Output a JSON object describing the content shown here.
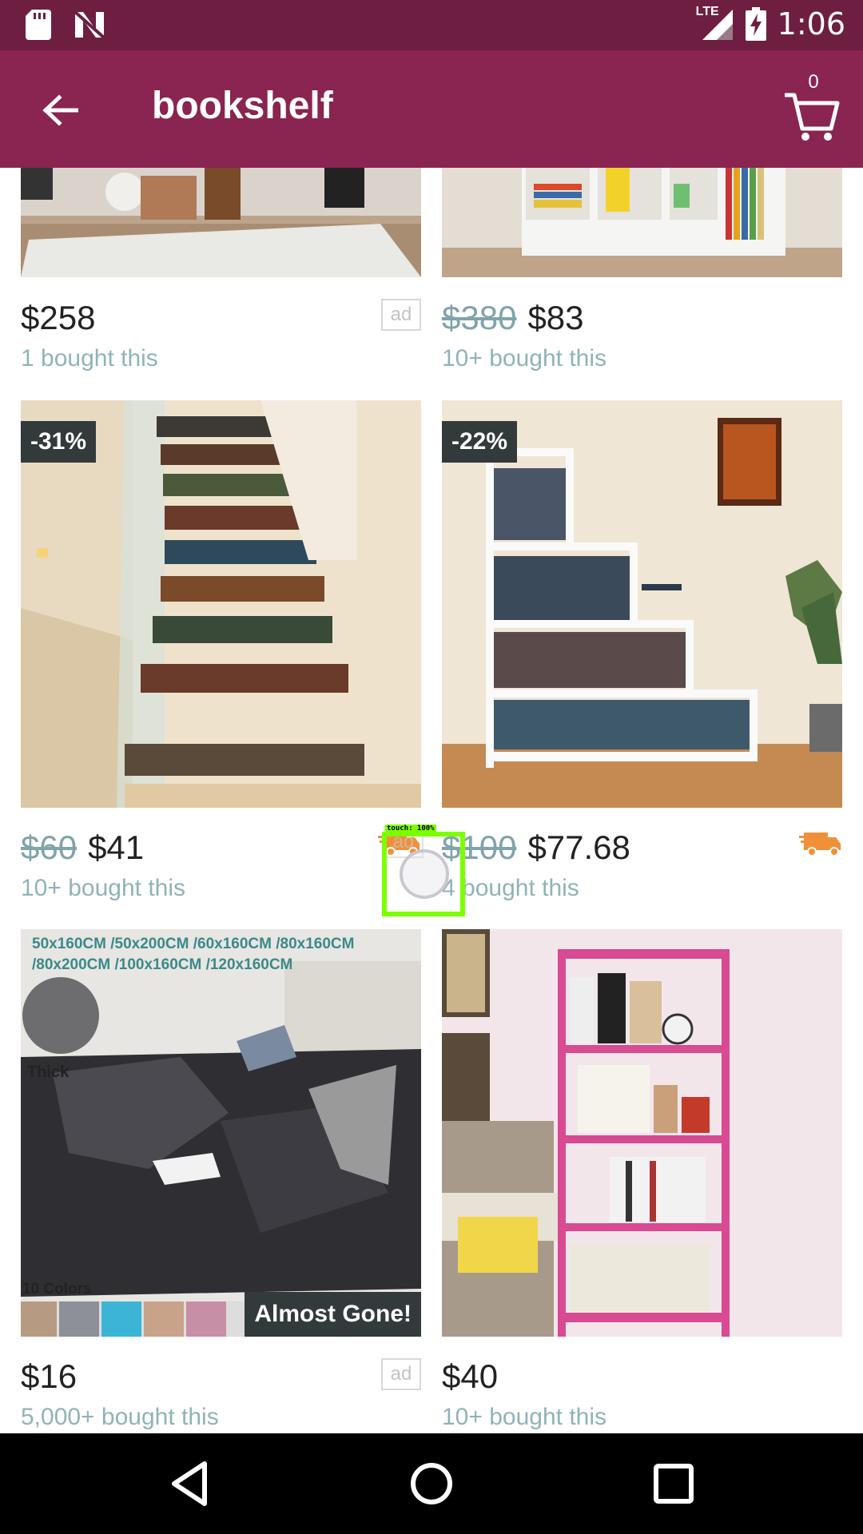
{
  "status_bar": {
    "time": "1:06",
    "network": "LTE",
    "icons": [
      "sd-card-icon",
      "n-notification-icon",
      "signal-icon",
      "battery-charging-icon"
    ]
  },
  "app_bar": {
    "title": "bookshelf",
    "cart_count": "0",
    "back_icon": "arrow-back-icon",
    "cart_icon": "cart-icon"
  },
  "products": [
    {
      "price": "$258",
      "old_price": "",
      "bought": "1 bought this",
      "ad": "ad",
      "discount": "",
      "free_shipping": false
    },
    {
      "price": "$83",
      "old_price": "$380",
      "bought": "10+ bought this",
      "ad": "",
      "discount": "",
      "free_shipping": false
    },
    {
      "price": "$41",
      "old_price": "$60",
      "bought": "10+ bought this",
      "ad": "",
      "discount": "-31%",
      "free_shipping": true
    },
    {
      "price": "$77.68",
      "old_price": "$100",
      "bought": "4 bought this",
      "ad": "",
      "discount": "-22%",
      "free_shipping": true
    },
    {
      "price": "$16",
      "old_price": "",
      "bought": "5,000+ bought this",
      "ad": "ad",
      "discount": "",
      "free_shipping": false,
      "image_text": {
        "sizes_line1": "50x160CM /50x200CM /60x160CM /80x160CM",
        "sizes_line2": "/80x200CM /100x160CM /120x160CM",
        "thick": "Thick",
        "colors": "10 Colors",
        "stock_label": "Almost Gone!"
      }
    },
    {
      "price": "$40",
      "old_price": "",
      "bought": "10+ bought this",
      "ad": "",
      "discount": "",
      "free_shipping": false
    }
  ],
  "floating_ad_label": "ad",
  "touch_indicator": {
    "label": "touch: 100%"
  },
  "colors": {
    "status_bar": "#6e1f41",
    "app_bar": "#8a2450",
    "truck": "#f0913a",
    "badge": "#333a3c",
    "bought_text": "#8fb3b8"
  }
}
